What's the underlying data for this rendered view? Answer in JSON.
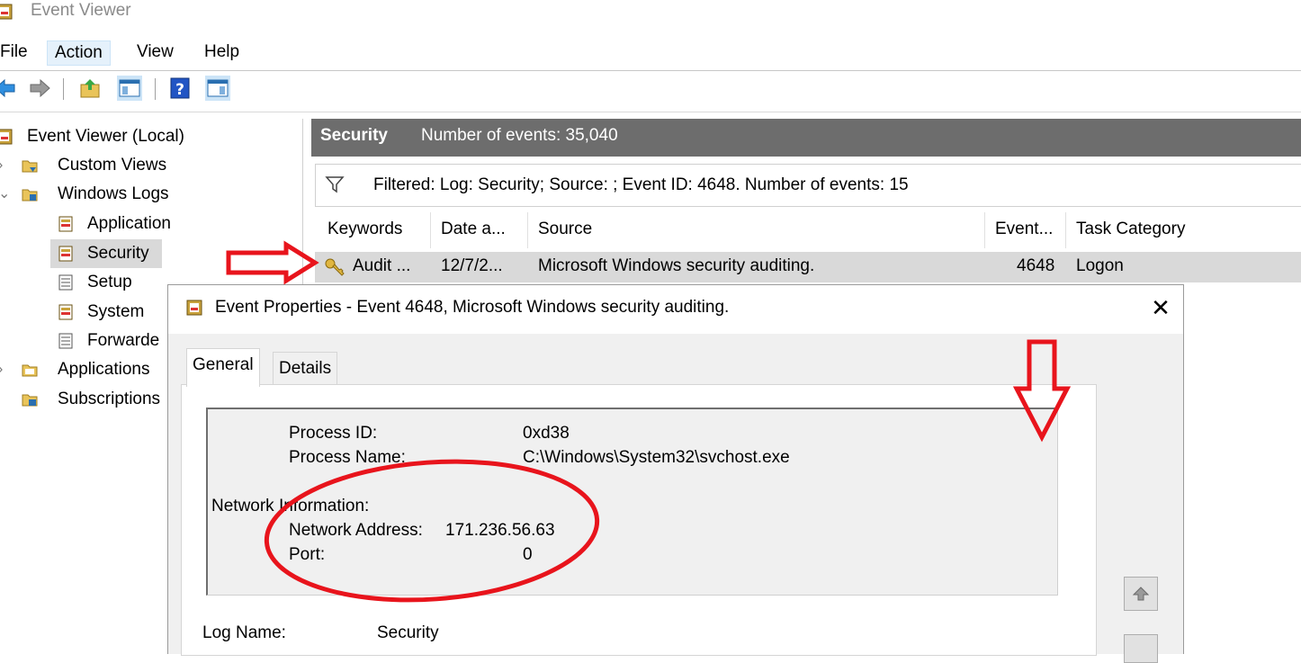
{
  "window": {
    "title": "Event Viewer",
    "app_icon": "event-viewer-icon"
  },
  "menu": {
    "items": [
      "File",
      "Action",
      "View",
      "Help"
    ],
    "active": "Action"
  },
  "toolbar": {
    "buttons": [
      "back-arrow-icon",
      "forward-arrow-icon",
      "up-folder-icon",
      "show-hide-console-tree-icon",
      "help-icon",
      "show-hide-action-pane-icon"
    ]
  },
  "tree": {
    "root": "Event Viewer (Local)",
    "custom_views": "Custom Views",
    "windows_logs": "Windows Logs",
    "application": "Application",
    "security": "Security",
    "setup": "Setup",
    "system": "System",
    "forwarded": "Forwarde",
    "apps_services": "Applications",
    "subscriptions": "Subscriptions"
  },
  "log_header": {
    "name": "Security",
    "count_text": "Number of events: 35,040"
  },
  "filter": {
    "text": "Filtered: Log: Security; Source: ; Event ID: 4648. Number of events: 15"
  },
  "columns": [
    "Keywords",
    "Date a...",
    "Source",
    "Event...",
    "Task Category"
  ],
  "rows": [
    {
      "keywords": "Audit ...",
      "date": "12/7/2...",
      "source": "Microsoft Windows security auditing.",
      "event_id": "4648",
      "task_category": "Logon"
    }
  ],
  "dialog": {
    "title": "Event Properties - Event 4648, Microsoft Windows security auditing.",
    "close_glyph": "✕",
    "tabs": [
      "General",
      "Details"
    ],
    "details": {
      "process_id_label": "Process ID:",
      "process_id_value": "0xd38",
      "process_name_label": "Process Name:",
      "process_name_value": "C:\\Windows\\System32\\svchost.exe",
      "network_section": "Network Information:",
      "network_address_label": "Network Address:",
      "network_address_value": "171.236.56.63",
      "port_label": "Port:",
      "port_value": "0"
    },
    "log_name_label": "Log Name:",
    "log_name_value": "Security"
  },
  "annotation_colors": {
    "red": "#e8141c"
  }
}
